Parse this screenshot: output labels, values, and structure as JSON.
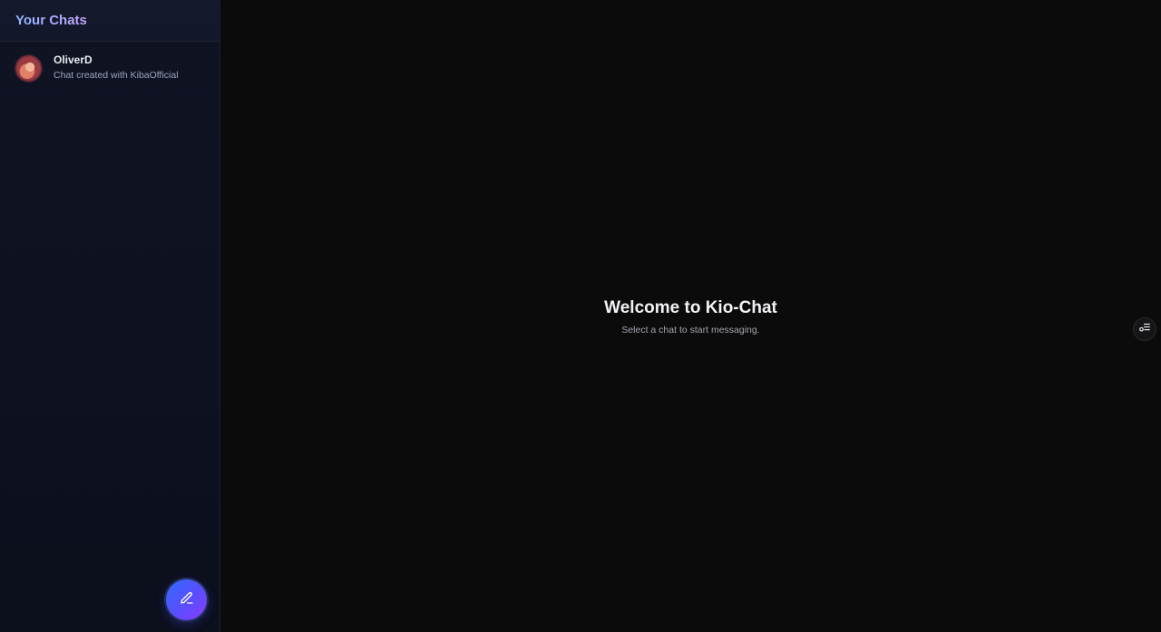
{
  "sidebar": {
    "title": "Your Chats",
    "chats": [
      {
        "name": "OliverD",
        "preview": "Chat created with KibaOfficial"
      }
    ],
    "new_chat_icon": "pencil-icon"
  },
  "main": {
    "welcome_title": "Welcome to Kio-Chat",
    "welcome_subtitle": "Select a chat to start messaging.",
    "panel_toggle_icon": "settings-list-icon"
  },
  "colors": {
    "accent_start": "#2f6bff",
    "accent_end": "#8a3dff",
    "title_gradient_start": "#8fb4ff",
    "title_gradient_end": "#c6a6ff",
    "background": "#0b0b0c",
    "sidebar_bg": "#0f1322"
  }
}
